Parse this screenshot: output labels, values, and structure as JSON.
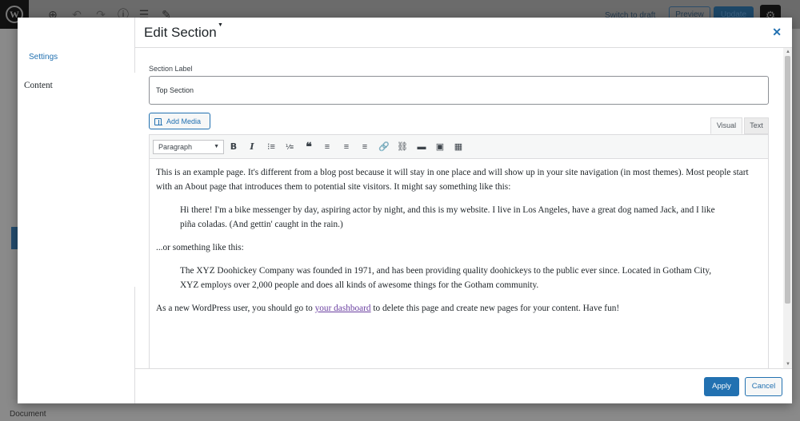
{
  "background": {
    "switch_to_draft": "Switch to draft",
    "preview_label": "Preview",
    "update_label": "Update",
    "document_label": "Document"
  },
  "sidebar": {
    "items": [
      {
        "label": "Settings"
      },
      {
        "label": "Content"
      }
    ]
  },
  "header": {
    "title": "Edit Section"
  },
  "form": {
    "section_label": "Section Label",
    "section_value": "Top Section",
    "add_media_label": "Add Media"
  },
  "editor": {
    "tabs": [
      {
        "label": "Visual"
      },
      {
        "label": "Text"
      }
    ],
    "format_select": "Paragraph",
    "paragraphs": {
      "p1": "This is an example page. It's different from a blog post because it will stay in one place and will show up in your site navigation (in most themes). Most people start with an About page that introduces them to potential site visitors. It might say something like this:",
      "quote1": "Hi there! I'm a bike messenger by day, aspiring actor by night, and this is my website. I live in Los Angeles, have a great dog named Jack, and I like piña coladas. (And gettin' caught in the rain.)",
      "p2": "...or something like this:",
      "quote2": "The XYZ Doohickey Company was founded in 1971, and has been providing quality doohickeys to the public ever since. Located in Gotham City, XYZ employs over 2,000 people and does all kinds of awesome things for the Gotham community.",
      "p3_before": "As a new WordPress user, you should go to ",
      "p3_link": "your dashboard",
      "p3_after": " to delete this page and create new pages for your content. Have fun!"
    }
  },
  "footer": {
    "apply_label": "Apply",
    "cancel_label": "Cancel"
  },
  "colors": {
    "accent": "#2271b1",
    "link_visited": "#6a3fa0"
  }
}
